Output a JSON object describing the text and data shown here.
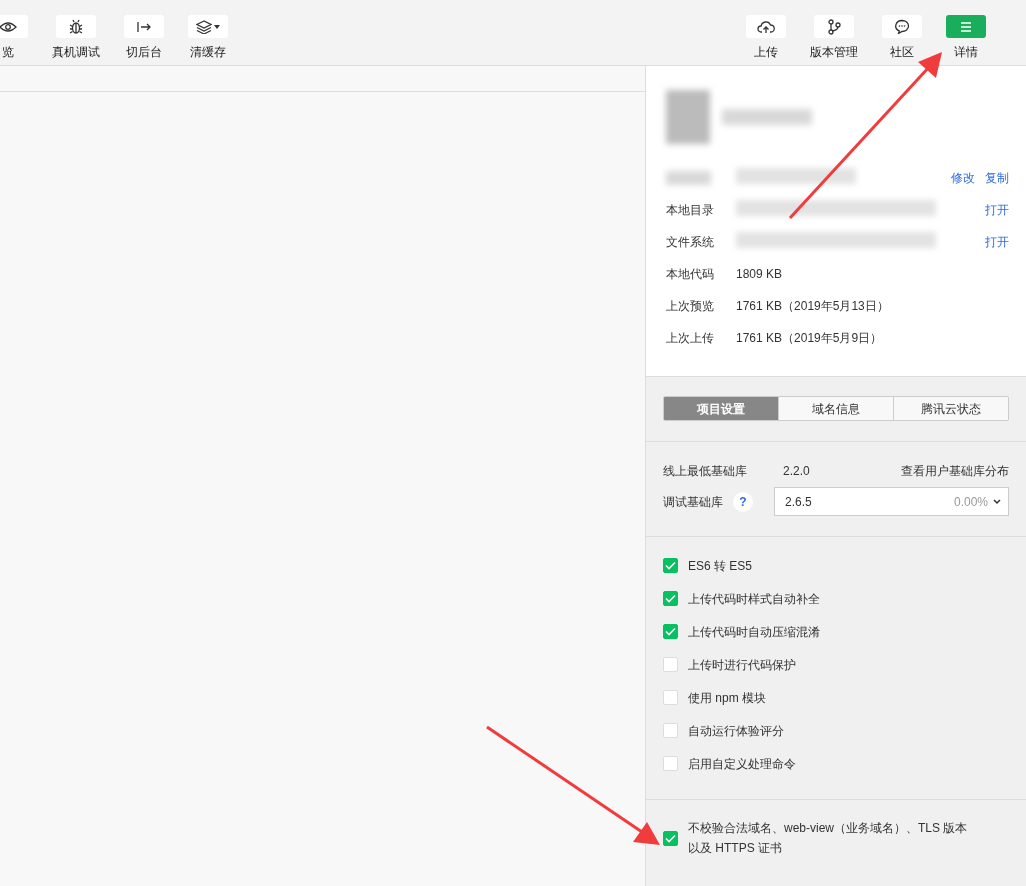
{
  "toolbar": {
    "left": [
      {
        "label": "览",
        "dropdown": false
      },
      {
        "label": "真机调试",
        "dropdown": false
      },
      {
        "label": "切后台",
        "dropdown": false
      },
      {
        "label": "清缓存",
        "dropdown": true
      }
    ],
    "right": [
      {
        "label": "上传",
        "selected": false
      },
      {
        "label": "版本管理",
        "selected": false
      },
      {
        "label": "社区",
        "selected": false
      },
      {
        "label": "详情",
        "selected": true
      }
    ]
  },
  "details": {
    "rows": [
      {
        "kind": "redacted",
        "actions": [
          "修改",
          "复制"
        ]
      },
      {
        "kind": "redacted",
        "label": "本地目录",
        "actions": [
          "打开"
        ]
      },
      {
        "kind": "redacted",
        "label": "文件系统",
        "actions": [
          "打开"
        ]
      },
      {
        "kind": "text",
        "label": "本地代码",
        "value": "1809 KB"
      },
      {
        "kind": "text",
        "label": "上次预览",
        "value": "1761 KB（2019年5月13日）"
      },
      {
        "kind": "text",
        "label": "上次上传",
        "value": "1761 KB（2019年5月9日）"
      }
    ]
  },
  "tabs": [
    {
      "label": "项目设置",
      "selected": true
    },
    {
      "label": "域名信息",
      "selected": false
    },
    {
      "label": "腾讯云状态",
      "selected": false
    }
  ],
  "base_library": {
    "label": "线上最低基础库",
    "value": "2.2.0",
    "link": "查看用户基础库分布"
  },
  "debug_library": {
    "label": "调试基础库",
    "help": "?",
    "value": "2.6.5",
    "usage": "0.00%"
  },
  "options": [
    {
      "label": "ES6 转 ES5",
      "checked": true
    },
    {
      "label": "上传代码时样式自动补全",
      "checked": true
    },
    {
      "label": "上传代码时自动压缩混淆",
      "checked": true
    },
    {
      "label": "上传时进行代码保护",
      "checked": false
    },
    {
      "label": "使用 npm 模块",
      "checked": false
    },
    {
      "label": "自动运行体验评分",
      "checked": false
    },
    {
      "label": "启用自定义处理命令",
      "checked": false
    }
  ],
  "extra_options": [
    {
      "label": "不校验合法域名、web-view（业务域名）、TLS 版本以及 HTTPS 证书",
      "checked": true
    }
  ]
}
